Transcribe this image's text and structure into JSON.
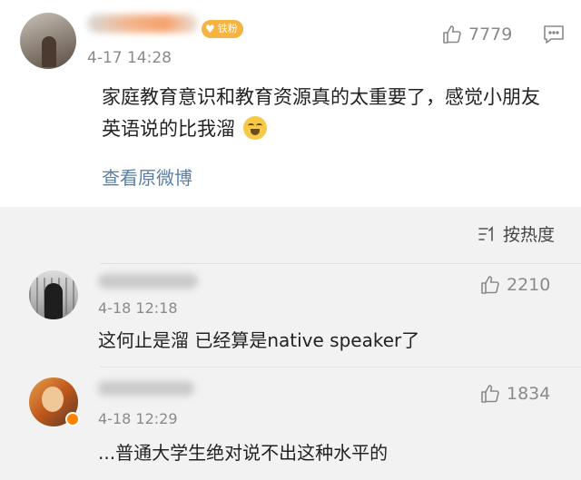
{
  "main_comment": {
    "username": "",
    "badge_label": "铁粉",
    "timestamp": "4-17 14:28",
    "like_count": "7779",
    "text": "家庭教育意识和教育资源真的太重要了，感觉小朋友英语说的比我溜",
    "emoji": "laugh-cry-emoji",
    "view_original_label": "查看原微博"
  },
  "sort": {
    "label": "按热度",
    "icon": "sort-icon"
  },
  "replies": [
    {
      "username": "",
      "timestamp": "4-18 12:18",
      "like_count": "2210",
      "text": "这何止是溜 已经算是native speaker了"
    },
    {
      "username": "",
      "timestamp": "4-18 12:29",
      "like_count": "1834",
      "text": "...普通大学生绝对说不出这种水平的"
    }
  ],
  "colors": {
    "link": "#5b7fa6",
    "badge": "#f5b342",
    "vip": "#ff8200",
    "background": "#f2f2f2",
    "card": "#ffffff"
  }
}
